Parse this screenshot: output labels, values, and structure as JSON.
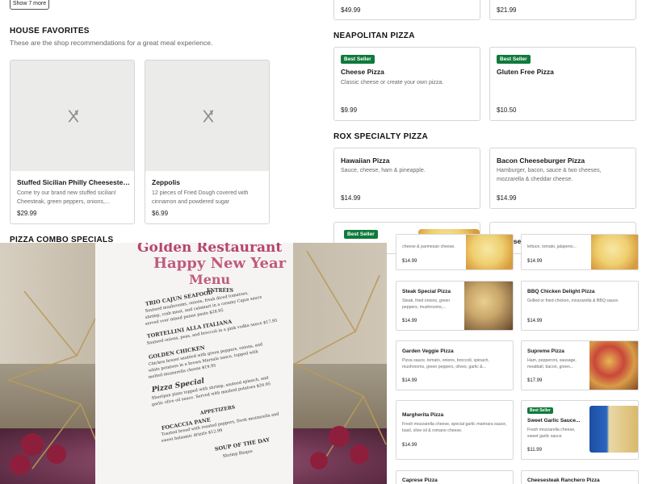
{
  "header": {
    "show_more_label": "Show 7 more"
  },
  "house_favorites": {
    "title": "HOUSE FAVORITES",
    "subtitle": "These are the shop recommendations for a great meal experience.",
    "items": [
      {
        "name": "Stuffed Sicilian Philly Cheesesteak Piz...",
        "desc": "Come try our brand new stuffed sicilian! Cheesteak, green peppers, onions,...",
        "price": "$29.99"
      },
      {
        "name": "Zeppolis",
        "desc": "12 pieces of Fried Dough covered with cinnamon and powdered sugar",
        "price": "$6.99"
      }
    ]
  },
  "pizza_combo": {
    "title": "PIZZA COMBO SPECIALS"
  },
  "top_prices": {
    "left": "$49.99",
    "right": "$21.99"
  },
  "neapolitan": {
    "title": "NEAPOLITAN PIZZA",
    "items": [
      {
        "badge": "Best Seller",
        "name": "Cheese Pizza",
        "desc": "Classic cheese or create your own pizza.",
        "price": "$9.99"
      },
      {
        "badge": "Best Seller",
        "name": "Gluten Free Pizza",
        "desc": "",
        "price": "$10.50"
      }
    ]
  },
  "rox_specialty": {
    "title": "ROX SPECIALTY PIZZA",
    "items": [
      {
        "name": "Hawaiian Pizza",
        "desc": "Sauce, cheese, ham & pineapple.",
        "price": "$14.99"
      },
      {
        "name": "Bacon Cheeseburger Pizza",
        "desc": "Hamburger, bacon, sauce & two cheeses, mozzarella & cheddar cheese.",
        "price": "$14.99"
      }
    ],
    "partial_badge": "Best Seller",
    "partial_name": "Cheesesteak Pizza"
  },
  "photo": {
    "sign_title": "Golden Restaurant",
    "title_line1": "Happy New Year",
    "title_line2": "Menu",
    "entrees": "ENTRÉES",
    "lines": [
      "TRIO CAJUN SEAFOOD",
      "Sauteed mushrooms, onions, fresh diced tomatoes,",
      "shrimp, crab meat, and calamari in a creamy Cajun sauce",
      "served over mixed penne pasta $28.95",
      "TORTELLINI ALLA ITALIANA",
      "Sauteed onions, peas, and broccoli in a pink vodka sauce $17.95",
      "GOLDEN CHICKEN",
      "Chicken breast sautéed with green peppers, onions, and",
      "white potatoes in a brown Marsala sauce, topped with",
      "melted mozzarella cheese $19.95",
      "Pizza Special",
      "Sheetpan pizza topped with shrimp, sauteed spinach, and",
      "garlic olive oil sauce. Served with mashed potatoes $26.95",
      "APPETIZERS",
      "FOCACCIA PANE",
      "Toasted bread with roasted peppers, fresh mozzarella and",
      "sweet balsamic drizzle $12.99",
      "SOUP OF THE DAY",
      "Shrimp Bisque"
    ]
  },
  "mini_cards": [
    {
      "name": "",
      "desc": "cheese & parmesan cheese.",
      "price": "$14.99",
      "has_image": true,
      "img": "cheese"
    },
    {
      "name": "",
      "desc": "lettuce, tomato, jalapeno...",
      "price": "$14.99",
      "has_image": true,
      "img": "cheese"
    },
    {
      "name": "Steak Special Pizza",
      "desc": "Steak, fried onions, green peppers, mushrooms,...",
      "price": "$14.99",
      "has_image": true,
      "img": "steak"
    },
    {
      "name": "BBQ Chicken Delight Pizza",
      "desc": "Grilled or fried chicken, mozzarella & BBQ sauce.",
      "price": "$14.99",
      "has_image": false
    },
    {
      "name": "Garden Veggie Pizza",
      "desc": "Pizza sauce, tomato, onions, broccoli, spinach, mushrooms, green peppers, olives, garlic &...",
      "price": "$14.99",
      "has_image": true,
      "img": "veg"
    },
    {
      "name": "Supreme Pizza",
      "desc": "Ham, pepperoni, sausage, meatball, bacon, green...",
      "price": "$17.99",
      "has_image": true,
      "img": "supreme"
    },
    {
      "name": "Margherita Pizza",
      "desc": "Fresh mozzarella cheese, special garlic marinara sauce, basil, olive oil & romano cheese.",
      "price": "$14.99",
      "has_image": false
    },
    {
      "badge": "Best Seller",
      "name": "Sweet Garlic Sauce...",
      "desc": "Fresh mozzarella cheese, sweet garlic sauce",
      "price": "$11.99",
      "has_image": true,
      "img": "soda"
    },
    {
      "name": "Caprese Pizza",
      "desc": "",
      "price": "",
      "has_image": false
    },
    {
      "name": "Cheesesteak Ranchero Pizza",
      "desc": "",
      "price": "",
      "has_image": false
    }
  ]
}
